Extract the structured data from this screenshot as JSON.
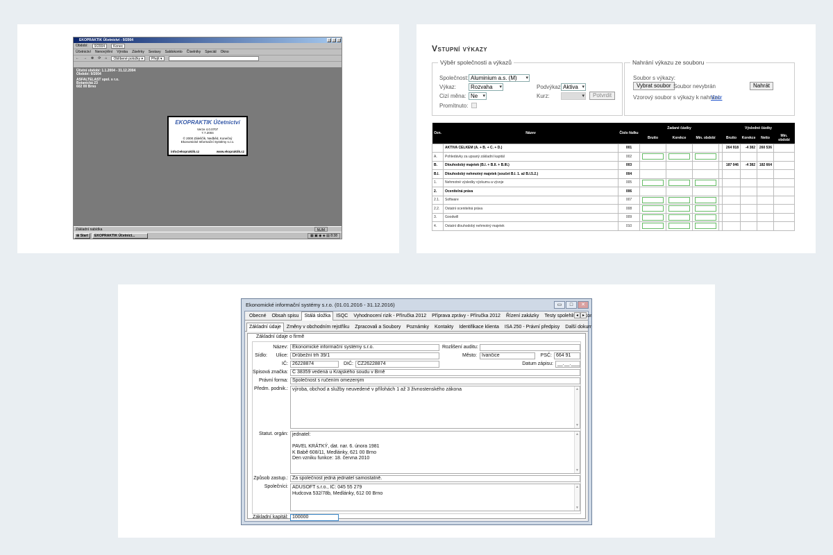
{
  "card1": {
    "title": "EKOPRAKTIK Účetnictví - 9/2004",
    "row1": {
      "obdobi_label": "Období:",
      "obdobi_value": "9/2004",
      "konec": "Konec"
    },
    "menu": [
      "Účetnictví",
      "Nenový/ění",
      "Výroba",
      "Závěrky",
      "Sestavy",
      "Saldokonto",
      "Číselníky",
      "Speciál",
      "Okno"
    ],
    "toolbar": {
      "back": "←",
      "forward": "→",
      "oblibene": "Oblíbené položky ▾",
      "prejit": "Přejít ▾"
    },
    "desk_lines": [
      "Účetní období: 1.1.2004 - 31.12.2004",
      "Období: 9/2004",
      "",
      "ASFALTELAST spol. s r.o.",
      "Botanická 23",
      "602 00 Brno"
    ],
    "splash": {
      "name": "EKOPRAKTIK Účetnictví",
      "version": "Verze 4.0.0707",
      "date": "7.7.2004",
      "copyright": "© 2000 Záleščík, Nedběd, Konečný",
      "company": "Ekonomické Informační Systémy s.r.o.",
      "email": "info@ekopraktik.cz",
      "web": "www.ekopraktik.cz"
    },
    "status": {
      "text": "Základní nabídka",
      "num": "NUM"
    },
    "taskbar": {
      "start": "Start",
      "task": "EKOPRAKTIK Účetnict...",
      "clock": "8:38"
    }
  },
  "card2": {
    "title": "Vstupní výkazy",
    "fs1": {
      "legend": "Výběr společnosti a výkazů",
      "spolecnost_label": "Společnost:",
      "spolecnost_value": "Aluminium a.s. (M)",
      "vykaz_label": "Výkaz:",
      "vykaz_value": "Rozvaha",
      "podvykaz_label": "Podvýkaz:",
      "podvykaz_value": "Aktiva",
      "mena_label": "Cizí měna:",
      "mena_value": "Ne",
      "kurz_label": "Kurz:",
      "potvrdit": "Potvrdit",
      "promitnuto_label": "Promítnuto:"
    },
    "fs2": {
      "legend": "Nahrání výkazu ze souboru",
      "soubor_label": "Soubor s výkazy:",
      "vybrat": "Vybrat soubor",
      "nevybran": "Soubor nevybrán",
      "nahrat": "Nahrát",
      "vzor_label": "Vzorový soubor s výkazy k nahrání:",
      "vzor_link": "Vzor"
    },
    "table": {
      "headers": {
        "ozn": "Ozn.",
        "nazev": "Název",
        "cislo": "Číslo řádku",
        "zadane": "Zadané částky",
        "vysledne": "Výsledné částky"
      },
      "sub_zadane": [
        "Brutto",
        "Korekce",
        "Min. období"
      ],
      "sub_vysledne": [
        "Brutto",
        "Korekce",
        "Netto",
        "Min. období"
      ],
      "rows": [
        {
          "ozn": "",
          "nazev": "AKTIVA CELKEM (A. + B. + C. + D.)",
          "cislo": "001",
          "bold": true,
          "inputs": false,
          "brutto": "264 918",
          "korekce": "-4 382",
          "netto": "260 536"
        },
        {
          "ozn": "A.",
          "nazev": "Pohledávky za upsaný základní kapitál",
          "cislo": "002",
          "bold": false,
          "inputs": true,
          "brutto": "",
          "korekce": "",
          "netto": ""
        },
        {
          "ozn": "B.",
          "nazev": "Dlouhodobý majetek (B.I. + B.II. + B.III.)",
          "cislo": "003",
          "bold": true,
          "inputs": false,
          "brutto": "187 046",
          "korekce": "-4 382",
          "netto": "182 664"
        },
        {
          "ozn": "B.I.",
          "nazev": "Dlouhodobý nehmotný majetek (součet B.I. 1. až B.I.5.2.)",
          "cislo": "004",
          "bold": true,
          "inputs": false,
          "brutto": "",
          "korekce": "",
          "netto": ""
        },
        {
          "ozn": "1.",
          "nazev": "Nehmotné výsledky výzkumu a vývoje",
          "cislo": "005",
          "bold": false,
          "inputs": true,
          "brutto": "",
          "korekce": "",
          "netto": ""
        },
        {
          "ozn": "2.",
          "nazev": "Ocenitelná práva",
          "cislo": "006",
          "bold": true,
          "inputs": false,
          "brutto": "",
          "korekce": "",
          "netto": ""
        },
        {
          "ozn": "2.1.",
          "nazev": "Software",
          "cislo": "007",
          "bold": false,
          "inputs": true,
          "brutto": "",
          "korekce": "",
          "netto": ""
        },
        {
          "ozn": "2.2.",
          "nazev": "Ostatní ocenitelná práva",
          "cislo": "008",
          "bold": false,
          "inputs": true,
          "brutto": "",
          "korekce": "",
          "netto": ""
        },
        {
          "ozn": "3.",
          "nazev": "Goodwill",
          "cislo": "009",
          "bold": false,
          "inputs": true,
          "brutto": "",
          "korekce": "",
          "netto": ""
        },
        {
          "ozn": "4.",
          "nazev": "Ostatní dlouhodobý nehmotný majetek",
          "cislo": "010",
          "bold": false,
          "inputs": true,
          "brutto": "",
          "korekce": "",
          "netto": ""
        }
      ]
    }
  },
  "card3": {
    "title": "Ekonomické informační systémy s.r.o. (01.01.2016 - 31.12.2016)",
    "tabs": [
      "Obecné",
      "Obsah spisu",
      "Stálá složka",
      "ISQC",
      "Vyhodnocení rizik - Příručka 2012",
      "Příprava zprávy - Příručka 2012",
      "Řízení zakázky",
      "Testy spolehlivosti kontrol",
      "Vý"
    ],
    "subtabs": [
      "Základní údaje",
      "Změny v obchodním rejstříku",
      "Zpracovali a Soubory",
      "Poznámky",
      "Kontakty",
      "Identifikace klienta",
      "ISA 250 - Právní předpisy",
      "Další dokumenty"
    ],
    "group": "Základní údaje o firmě",
    "labels": {
      "nazev": "Název:",
      "sidlo": "Sídlo:",
      "ulice": "Ulice:",
      "ic": "IČ:",
      "dic": "DIČ:",
      "rozliseni": "Rozlišení auditu:",
      "mesto": "Město:",
      "psc": "PSČ:",
      "datum": "Datum zápisu:",
      "spis": "Spisová značka:",
      "forma": "Právní forma:",
      "predm": "Předm. podnik.:",
      "statut": "Statut. orgán:",
      "zpusob": "Způsob zastup.:",
      "spolecnici": "Společníci:",
      "kapital": "Základní kapitál:"
    },
    "values": {
      "nazev": "Ekonomické informační systémy s.r.o.",
      "ulice": "Drůbežní trh 39/1",
      "ic": "26228874",
      "dic": "CZ26228874",
      "mesto": "Ivančice",
      "psc": "664 91",
      "datum": "__.__.____",
      "spis": "C 38359 vedená u Krajského soudu v Brně",
      "forma": "Společnost s ručením omezeným",
      "predm": "výroba, obchod a služby neuvedené v přílohách 1 až 3 živnostenského zákona",
      "statut": "jednatel:\n\nPAVEL KRÁTKÝ, dat. nar. 6. února 1981\nK Babě 608/11, Medlánky, 621 00 Brno\nDen vzniku funkce: 18. června 2010",
      "zpusob": "Za společnost jedná jednatel samostatně.",
      "spolecnici": "ADUSOFT s.r.o., IČ: 045 55 279\nHudcova 532/78b, Medlánky, 612 00 Brno",
      "kapital": "100000"
    }
  }
}
